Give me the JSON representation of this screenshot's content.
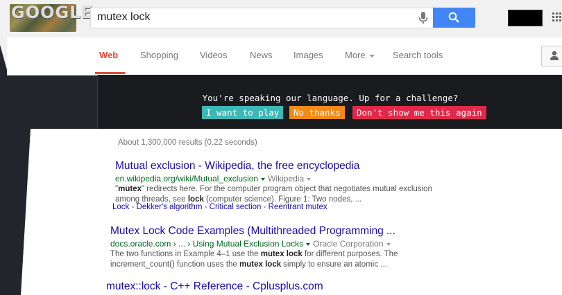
{
  "header": {
    "logo_text": "GOOGLE",
    "search_query": "mutex lock"
  },
  "nav": {
    "tabs": [
      {
        "label": "Web",
        "active": true
      },
      {
        "label": "Shopping"
      },
      {
        "label": "Videos"
      },
      {
        "label": "News"
      },
      {
        "label": "Images"
      },
      {
        "label": "More"
      },
      {
        "label": "Search tools"
      }
    ]
  },
  "challenge": {
    "message": "You're speaking our language. Up for a challenge?",
    "play_label": "I want to play",
    "no_thanks_label": "No thanks",
    "dont_show_label": "Don't show me this again"
  },
  "results": {
    "stats": "About 1,300,000 results (0.22 seconds)",
    "items": [
      {
        "title": "Mutual exclusion - Wikipedia, the free encyclopedia",
        "url": "en.wikipedia.org/wiki/Mutual_exclusion",
        "source": "Wikipedia",
        "snippet_parts": [
          {
            "t": "\"",
            "b": false
          },
          {
            "t": "mutex",
            "b": true
          },
          {
            "t": "\" redirects here. For the computer program object that negotiates mutual exclusion among threads, see ",
            "b": false
          },
          {
            "t": "lock",
            "b": true
          },
          {
            "t": " (computer science). Figure 1: Two nodes,  ...",
            "b": false
          }
        ],
        "sitelinks": [
          "Lock",
          "Dekker's algorithm",
          "Critical section",
          "Reentrant mutex"
        ]
      },
      {
        "title": "Mutex Lock Code Examples (Multithreaded Programming ...",
        "url": "docs.oracle.com › ... › Using Mutual Exclusion Locks",
        "source": "Oracle Corporation",
        "snippet_parts": [
          {
            "t": "The two functions in Example 4–1 use the ",
            "b": false
          },
          {
            "t": "mutex lock",
            "b": true
          },
          {
            "t": " for different purposes. The increment_count() function uses the ",
            "b": false
          },
          {
            "t": "mutex lock",
            "b": true
          },
          {
            "t": " simply to ensure an atomic ...",
            "b": false
          }
        ]
      },
      {
        "title": "mutex::lock - C++ Reference - Cplusplus.com"
      }
    ]
  },
  "colors": {
    "accent": "#dd4b39",
    "link": "#1a0dab",
    "url_green": "#006621",
    "search_blue": "#4285f4",
    "play": "#3db8b6",
    "no_thanks": "#f18a19",
    "dont_show": "#e0294a"
  },
  "icons": [
    "mic-icon",
    "search-icon",
    "apps-icon",
    "account-icon"
  ]
}
